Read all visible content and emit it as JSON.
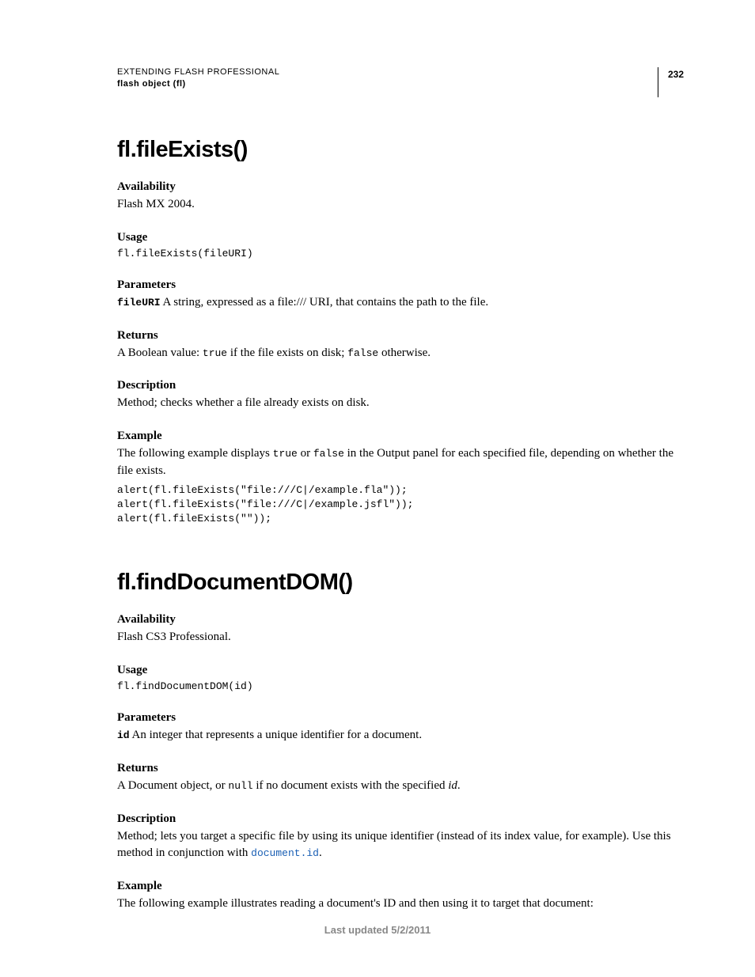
{
  "header": {
    "title": "EXTENDING FLASH PROFESSIONAL",
    "subtitle": "flash object (fl)",
    "page_number": "232"
  },
  "method1": {
    "title": "fl.fileExists()",
    "availability_label": "Availability",
    "availability_text": "Flash MX 2004.",
    "usage_label": "Usage",
    "usage_code": "fl.fileExists(fileURI)",
    "parameters_label": "Parameters",
    "param_name": "fileURI",
    "param_desc": "  A string, expressed as a file:/// URI, that contains the path to the file.",
    "returns_label": "Returns",
    "returns_pre": "A Boolean value: ",
    "returns_code1": "true",
    "returns_mid": " if the file exists on disk; ",
    "returns_code2": "false",
    "returns_post": " otherwise.",
    "description_label": "Description",
    "description_text": "Method; checks whether a file already exists on disk.",
    "example_label": "Example",
    "example_pre": "The following example displays ",
    "example_code1": "true",
    "example_mid": " or ",
    "example_code2": "false",
    "example_post": " in the Output panel for each specified file, depending on whether the file exists.",
    "example_code": "alert(fl.fileExists(\"file:///C|/example.fla\"));\nalert(fl.fileExists(\"file:///C|/example.jsfl\"));\nalert(fl.fileExists(\"\"));"
  },
  "method2": {
    "title": "fl.findDocumentDOM()",
    "availability_label": "Availability",
    "availability_text": "Flash CS3 Professional.",
    "usage_label": "Usage",
    "usage_code": "fl.findDocumentDOM(id)",
    "parameters_label": "Parameters",
    "param_name": "id",
    "param_desc": "  An integer that represents a unique identifier for a document.",
    "returns_label": "Returns",
    "returns_pre": "A Document object, or ",
    "returns_code1": "null",
    "returns_mid": " if no document exists with the specified ",
    "returns_italic": "id",
    "returns_post": ".",
    "description_label": "Description",
    "description_pre": "Method; lets you target a specific file by using its unique identifier (instead of its index value, for example). Use this method in conjunction with ",
    "description_link": "document.id",
    "description_post": ".",
    "example_label": "Example",
    "example_text": "The following example illustrates reading a document's ID and then using it to target that document:"
  },
  "footer": "Last updated 5/2/2011"
}
